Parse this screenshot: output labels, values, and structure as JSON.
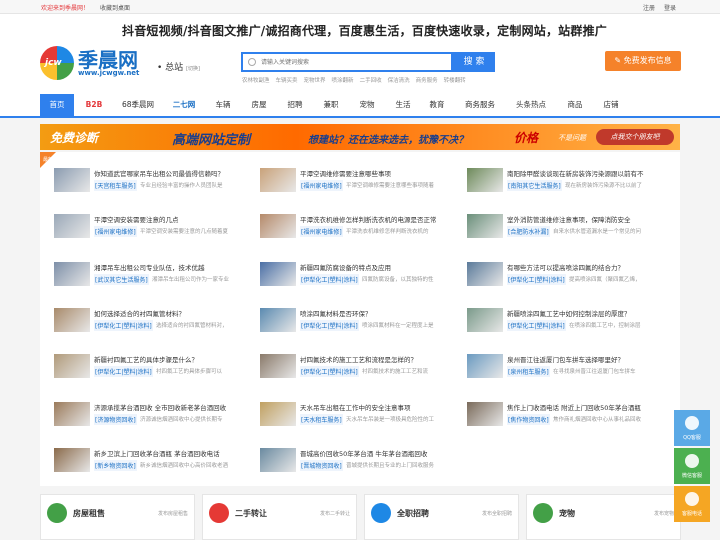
{
  "topbar": {
    "welcome": "欢迎来到季晨网！",
    "favorite": "收藏到桌面",
    "register": "注册",
    "login": "登录"
  },
  "header": {
    "slogan": "抖音短视频/抖音图文推广/诚招商代理，百度惠生活，百度快速收录，定制网站，站群推广",
    "logo_text": "季晨网",
    "logo_url": "www.jcwgw.net",
    "logo_badge": "jcw",
    "station": "总站",
    "station_sub": "[切换]",
    "search_placeholder": "请输入关键词搜索",
    "search_button": "搜 索",
    "hot_words": [
      "农林牧副渔",
      "车辆买卖",
      "宠物世界",
      "喷涂翻新",
      "二手回收",
      "保洁清洗",
      "商务服务",
      "转楼翻转"
    ],
    "publish_button": "免费发布信息"
  },
  "nav": [
    "首页",
    "B2B",
    "68季晨网",
    "二七网",
    "车辆",
    "房屋",
    "招聘",
    "兼职",
    "宠物",
    "生活",
    "教育",
    "商务服务",
    "头条热点",
    "商品",
    "店铺"
  ],
  "banner": {
    "part1": "免费诊断",
    "part2": "高端网站定制",
    "part3": "想建站？还在选来选去，犹豫不决？",
    "part4": "价格",
    "part5": "不是问题",
    "part6": "点我交个朋友吧"
  },
  "new_badge": "最新",
  "cards": [
    {
      "title": "你知道武官哪家吊车出租公司最值得信赖吗？",
      "tag": "[天宫租车服务]",
      "desc": "专业且经验丰富的操作人员团队是"
    },
    {
      "title": "平潭空调维修需要注意哪些事项",
      "tag": "[福州家电维修]",
      "desc": "平潭空调维修需要注意哪些事项随着"
    },
    {
      "title": "南阳除甲醛谈谈现在新房装饰污染源跟以前有不",
      "tag": "[南阳其它生活服务]",
      "desc": "现在新房装饰污染源不比以前了"
    },
    {
      "title": "平潭空调安装需要注意的几点",
      "tag": "[福州家电维修]",
      "desc": "平潭空调安装需要注意的几点随着夏"
    },
    {
      "title": "平潭洗衣机维修怎样判断洗衣机的电源是否正常",
      "tag": "[福州家电维修]",
      "desc": "平潭洗衣机维修怎样判断洗衣机的"
    },
    {
      "title": "室外消防管道维修注意事项，保障消防安全",
      "tag": "[合肥防水补漏]",
      "desc": "自来水供水管道漏水是一个常见的问"
    },
    {
      "title": "湘潭吊车出租公司专业队伍，技术优越",
      "tag": "[武汉其它生活服务]",
      "desc": "湘潭吊车出租公司作为一家专业"
    },
    {
      "title": "新疆四氟防腐设备的特点及应用",
      "tag": "[伊犁化工|塑料|涂料]",
      "desc": "四氟防腐设备，以其独特的性"
    },
    {
      "title": "有哪些方法可以提高喷涂四氟的结合力？",
      "tag": "[伊犁化工|塑料|涂料]",
      "desc": "提高喷涂四氟（聚四氟乙烯，"
    },
    {
      "title": "如何选择适合的衬四氟管材料？",
      "tag": "[伊犁化工|塑料|涂料]",
      "desc": "选择适合的衬四氟管材料对，"
    },
    {
      "title": "喷涂四氟材料是否环保？",
      "tag": "[伊犁化工|塑料|涂料]",
      "desc": "喷涂四氟材料在一定程度上是"
    },
    {
      "title": "新疆喷涂四氟工艺中如何控制涂层的厚度？",
      "tag": "[伊犁化工|塑料|涂料]",
      "desc": "在喷涂四氟工艺中，控制涂层"
    },
    {
      "title": "新疆衬四氟工艺的具体步骤是什么？",
      "tag": "[伊犁化工|塑料|涂料]",
      "desc": "衬四氟工艺的具体步骤可以"
    },
    {
      "title": "衬四氟技术的施工工艺和流程是怎样的？",
      "tag": "[伊犁化工|塑料|涂料]",
      "desc": "衬四氟技术的施工工艺和流"
    },
    {
      "title": "泉州晋江往返厦门包车拼车选择哪里好？",
      "tag": "[泉州租车服务]",
      "desc": "在寻找泉州晋江往返厦门包车拼车"
    },
    {
      "title": "济源承揽茅台酒回收 全市回收新老茅台酒回收",
      "tag": "[济源物资回收]",
      "desc": "济源诚信烟酒回收中心提供长期专"
    },
    {
      "title": "天水吊车出租在工作中的安全注意事项",
      "tag": "[天水租车服务]",
      "desc": "天水吊车吊装是一项极具危险性的工"
    },
    {
      "title": "焦作上门收酒电话 附近上门回收50年茅台酒瓶",
      "tag": "[焦作物资回收]",
      "desc": "焦作商礼烟酒回收中心从事礼品回收"
    },
    {
      "title": "新乡卫滨上门回收茅台酒瓶 茅台酒回收电话",
      "tag": "[新乡物资回收]",
      "desc": "新乡诚信烟酒回收中心高价回收老酒"
    },
    {
      "title": "晋城高价回收50年茅台酒 牛年茅台酒瓶回收",
      "tag": "[晋城物资回收]",
      "desc": "晋城提供长期且专业的上门回收服务"
    }
  ],
  "categories": [
    {
      "name": "房屋租售",
      "link": "发布房屋租售"
    },
    {
      "name": "二手转让",
      "link": "发布二手转让"
    },
    {
      "name": "全职招聘",
      "link": "发布全职招聘"
    },
    {
      "name": "宠物",
      "link": "发布宠物"
    }
  ],
  "float": [
    {
      "label": "QQ客服"
    },
    {
      "label": "微信客服"
    },
    {
      "label": "客服电话"
    }
  ],
  "colors": {
    "primary": "#2f80ed",
    "accent": "#f5822a",
    "red": "#e4393c"
  }
}
